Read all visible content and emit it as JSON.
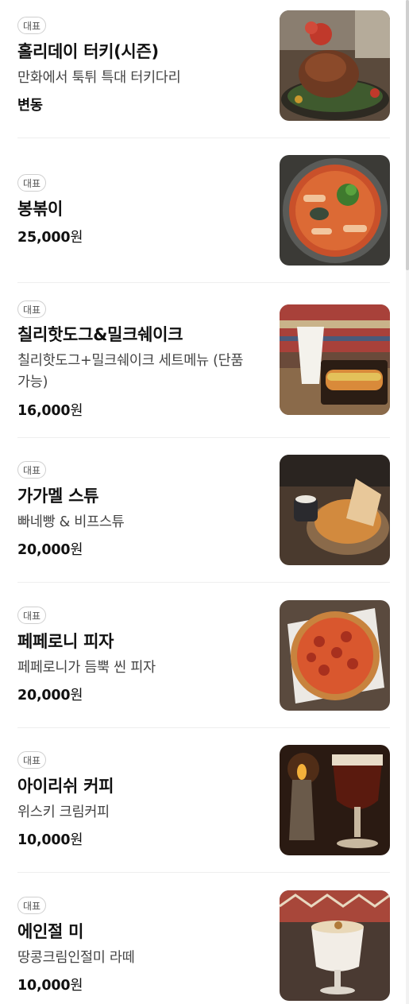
{
  "menu": {
    "items": [
      {
        "badge": "대표",
        "name": "홀리데이 터키(시즌)",
        "desc": "만화에서 툭튀 특대 터키다리",
        "price": "변동",
        "unit": "",
        "image": "roast-turkey-image"
      },
      {
        "badge": "대표",
        "name": "봉볶이",
        "desc": "",
        "price": "25,000",
        "unit": "원",
        "image": "tteokbokki-image"
      },
      {
        "badge": "대표",
        "name": "칠리핫도그&밀크쉐이크",
        "desc": "칠리핫도그+밀크쉐이크 세트메뉴 (단품 가능)",
        "price": "16,000",
        "unit": "원",
        "image": "hotdog-milkshake-image"
      },
      {
        "badge": "대표",
        "name": "가가멜 스튜",
        "desc": "빠네빵 & 비프스튜",
        "price": "20,000",
        "unit": "원",
        "image": "stew-image"
      },
      {
        "badge": "대표",
        "name": "페페로니 피자",
        "desc": "페페로니가 듬뿍 씬 피자",
        "price": "20,000",
        "unit": "원",
        "image": "pizza-image"
      },
      {
        "badge": "대표",
        "name": "아이리쉬 커피",
        "desc": "위스키 크림커피",
        "price": "10,000",
        "unit": "원",
        "image": "irish-coffee-image"
      },
      {
        "badge": "대표",
        "name": "에인절 미",
        "desc": "땅콩크림인절미 라떼",
        "price": "10,000",
        "unit": "원",
        "image": "latte-image"
      }
    ]
  }
}
